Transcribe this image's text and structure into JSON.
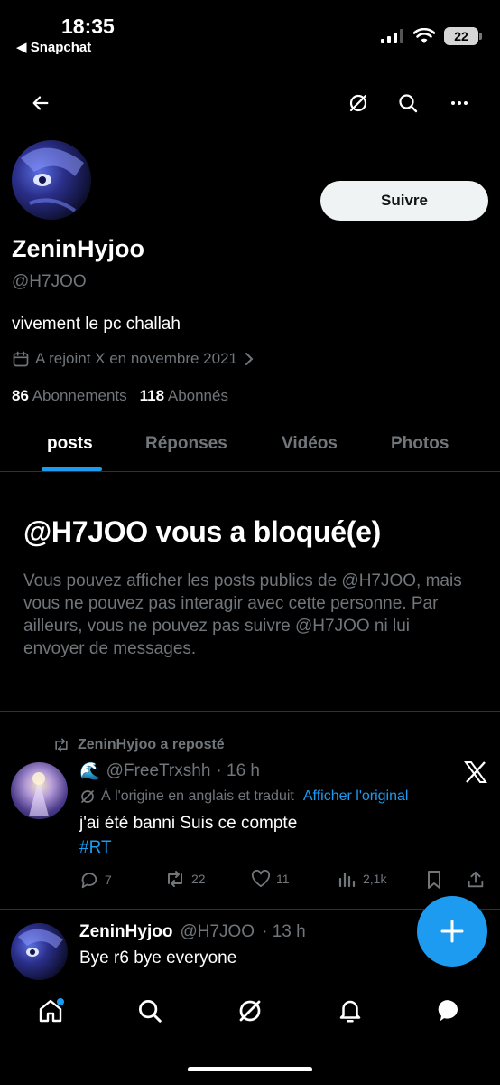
{
  "status_bar": {
    "time": "18:35",
    "back_app": "◀ Snapchat",
    "battery": "22"
  },
  "profile": {
    "name": "ZeninHyjoo",
    "handle": "@H7JOO",
    "bio": "vivement le pc challah",
    "joined": "A rejoint X en novembre 2021",
    "following_count": "86",
    "following_label": "Abonnements",
    "followers_count": "118",
    "followers_label": "Abonnés",
    "follow_button": "Suivre"
  },
  "tabs": [
    "posts",
    "Réponses",
    "Vidéos",
    "Photos"
  ],
  "blocked": {
    "title": "@H7JOO vous a bloqué(e)",
    "body": "Vous pouvez afficher les posts publics de @H7JOO, mais vous ne pouvez pas interagir avec cette personne. Par ailleurs, vous ne pouvez pas suivre @H7JOO ni lui envoyer de messages."
  },
  "post1": {
    "repost_label": "ZeninHyjoo a reposté",
    "author_emoji": "🌊",
    "author_handle": "@FreeTrxshh",
    "time": "· 16 h",
    "translated_note": "À l'origine en anglais et traduit",
    "show_original": "Afficher l'original",
    "text": "j'ai été banni Suis ce compte",
    "hashtag": "#RT",
    "replies": "7",
    "reposts": "22",
    "likes": "11",
    "views": "2,1k"
  },
  "post2": {
    "name": "ZeninHyjoo",
    "handle": "@H7JOO",
    "time": "· 13 h",
    "text": "Bye r6 bye everyone"
  },
  "colors": {
    "accent": "#1d9bf0",
    "muted": "#71767b",
    "background": "#000000"
  }
}
